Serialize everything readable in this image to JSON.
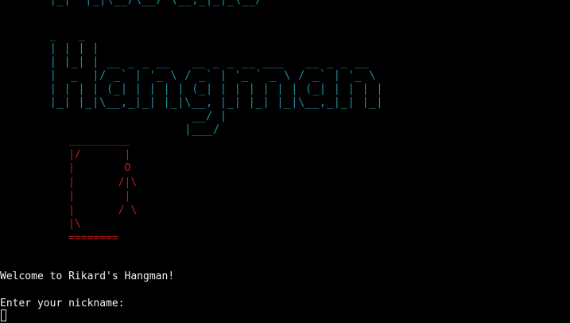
{
  "colors": {
    "background": "#000000",
    "banner": "#1f8c9e",
    "gallows": "#c81e1e",
    "text": "#f2f2f2"
  },
  "banner": {
    "top_fragment": "       |_|  |_|\\__/\\__/ \\__,_|_|_\\__/",
    "art": "       _   _\n       | | | |\n       | |_| | __ _ _ __   __ _ _ __ ___   __ _ _ __\n       |  _  |/ _` | '_ \\ / _` | '_ ` _ \\ / _` | '_ \\\n       | | | | (_| | | | | (_| | | | | | | (_| | | | |\n       |_| |_|\\__,_|_| |_|\\__, |_| |_| |_|\\__,_|_| |_|\n                           __/ |\n                          |___/"
  },
  "gallows": {
    "art": "           __________\n           |/       |\n           |        O\n           |       /|\\\n           |        |\n           |       / \\\n           |\\\n           ========"
  },
  "console": {
    "welcome": "Welcome to Rikard's Hangman!",
    "prompt": "Enter your nickname: "
  }
}
